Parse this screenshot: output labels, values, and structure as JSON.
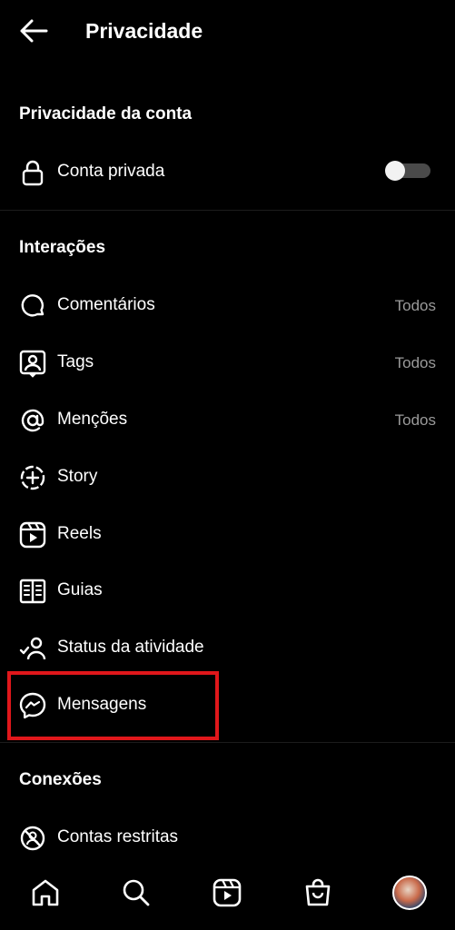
{
  "header": {
    "title": "Privacidade"
  },
  "sections": {
    "account_privacy": {
      "title": "Privacidade da conta",
      "private_account": {
        "label": "Conta privada",
        "enabled": false
      }
    },
    "interactions": {
      "title": "Interações",
      "items": [
        {
          "label": "Comentários",
          "value": "Todos",
          "icon": "comment-icon"
        },
        {
          "label": "Tags",
          "value": "Todos",
          "icon": "tag-person-icon"
        },
        {
          "label": "Menções",
          "value": "Todos",
          "icon": "at-sign-icon"
        },
        {
          "label": "Story",
          "value": "",
          "icon": "story-add-icon"
        },
        {
          "label": "Reels",
          "value": "",
          "icon": "reels-icon"
        },
        {
          "label": "Guias",
          "value": "",
          "icon": "guides-icon"
        },
        {
          "label": "Status da atividade",
          "value": "",
          "icon": "activity-status-icon"
        },
        {
          "label": "Mensagens",
          "value": "",
          "icon": "messenger-icon"
        }
      ]
    },
    "connections": {
      "title": "Conexões",
      "items": [
        {
          "label": "Contas restritas",
          "icon": "restricted-icon"
        }
      ]
    }
  },
  "colors": {
    "highlight": "#e0171b",
    "secondary_text": "#9a9a9a",
    "background": "#000000"
  },
  "bottom_nav": [
    "home-icon",
    "search-icon",
    "reels-icon",
    "shop-icon",
    "profile-avatar"
  ]
}
